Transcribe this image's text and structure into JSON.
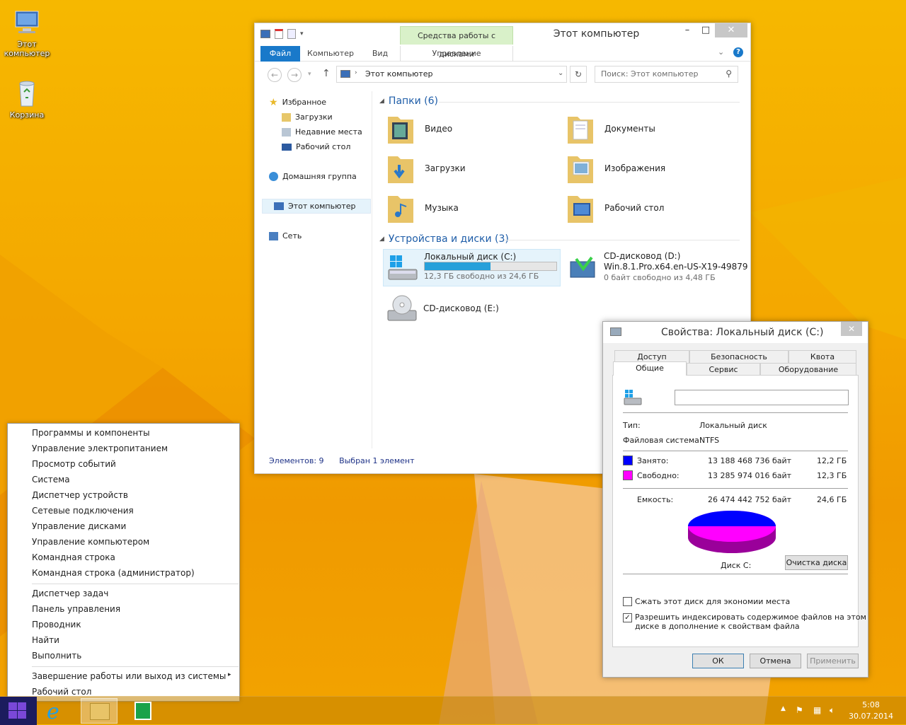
{
  "desktop": {
    "icons": [
      {
        "label": "Этот компьютер",
        "icon": "computer-icon"
      },
      {
        "label": "Корзина",
        "icon": "recycle-bin-icon"
      }
    ]
  },
  "explorer": {
    "title": "Этот компьютер",
    "contextual_tab": "Средства работы с дисками",
    "ribbon_tabs": {
      "file": "Файл",
      "computer": "Компьютер",
      "view": "Вид",
      "manage": "Управление"
    },
    "address": "Этот компьютер",
    "search_placeholder": "Поиск: Этот компьютер",
    "nav": {
      "favorites": "Избранное",
      "downloads": "Загрузки",
      "recent": "Недавние места",
      "desktop": "Рабочий стол",
      "homegroup": "Домашняя группа",
      "this_pc": "Этот компьютер",
      "network": "Сеть"
    },
    "folders_header": "Папки (6)",
    "folders": [
      {
        "name": "Видео"
      },
      {
        "name": "Документы"
      },
      {
        "name": "Загрузки"
      },
      {
        "name": "Изображения"
      },
      {
        "name": "Музыка"
      },
      {
        "name": "Рабочий стол"
      }
    ],
    "drives_header": "Устройства и диски (3)",
    "drives": [
      {
        "name": "Локальный диск (C:)",
        "free": "12,3 ГБ свободно из 24,6 ГБ",
        "used_fraction": 0.5
      },
      {
        "name": "CD-дисковод (D:)",
        "label": "Win.8.1.Pro.x64.en-US-X19-49879",
        "free": "0 байт свободно из 4,48 ГБ"
      },
      {
        "name": "CD-дисковод (E:)"
      }
    ],
    "status_items": "Элементов: 9",
    "status_selected": "Выбран 1 элемент"
  },
  "properties": {
    "title": "Свойства: Локальный диск (C:)",
    "tabs": {
      "access": "Доступ",
      "security": "Безопасность",
      "quota": "Квота",
      "general": "Общие",
      "service": "Сервис",
      "hardware": "Оборудование"
    },
    "name_value": "",
    "type_label": "Тип:",
    "type_value": "Локальный диск",
    "fs_label": "Файловая система:",
    "fs_value": "NTFS",
    "used_label": "Занято:",
    "used_bytes": "13 188 468 736 байт",
    "used_gb": "12,2 ГБ",
    "free_label": "Свободно:",
    "free_bytes": "13 285 974 016 байт",
    "free_gb": "12,3 ГБ",
    "capacity_label": "Емкость:",
    "capacity_bytes": "26 474 442 752 байт",
    "capacity_gb": "24,6 ГБ",
    "disk_label": "Диск C:",
    "cleanup_button": "Очистка диска",
    "compress_label": "Сжать этот диск для экономии места",
    "index_label_1": "Разрешить индексировать содержимое файлов на этом",
    "index_label_2": "диске в дополнение к свойствам файла",
    "ok": "ОК",
    "cancel": "Отмена",
    "apply": "Применить",
    "colors": {
      "used": "#0000ff",
      "free": "#ff00ff"
    }
  },
  "winx_menu": {
    "group1": [
      "Программы и компоненты",
      "Управление электропитанием",
      "Просмотр событий",
      "Система",
      "Диспетчер устройств",
      "Сетевые подключения",
      "Управление дисками",
      "Управление компьютером",
      "Командная строка",
      "Командная строка (администратор)"
    ],
    "group2": [
      "Диспетчер задач",
      "Панель управления",
      "Проводник",
      "Найти",
      "Выполнить"
    ],
    "group3": [
      "Завершение работы или выход из системы",
      "Рабочий стол"
    ]
  },
  "taskbar": {
    "time": "5:08",
    "date": "30.07.2014"
  }
}
